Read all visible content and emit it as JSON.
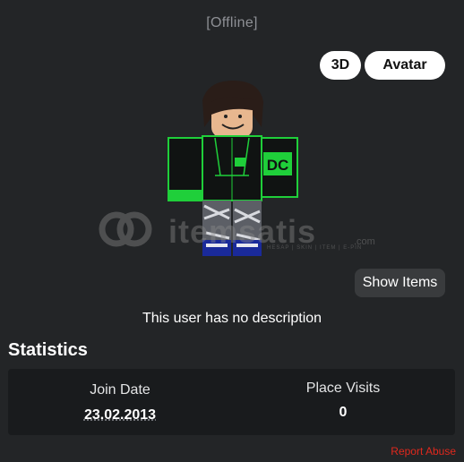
{
  "profile": {
    "status": "[Offline]",
    "view_toggle": {
      "three_d_label": "3D",
      "avatar_label": "Avatar"
    },
    "show_items_label": "Show Items",
    "description": "This user has no description"
  },
  "watermark": {
    "brand": "itemsatis",
    "tagline": "HESAP | SKIN | ITEM | E-PIN",
    "suffix": ".com"
  },
  "statistics": {
    "heading": "Statistics",
    "items": [
      {
        "label": "Join Date",
        "value": "23.02.2013"
      },
      {
        "label": "Place Visits",
        "value": "0"
      }
    ]
  },
  "footer": {
    "report_label": "Report Abuse"
  },
  "colors": {
    "background": "#232527",
    "panel": "#191b1d",
    "accent_green": "#1fcf3a",
    "report_red": "#e0281d"
  }
}
